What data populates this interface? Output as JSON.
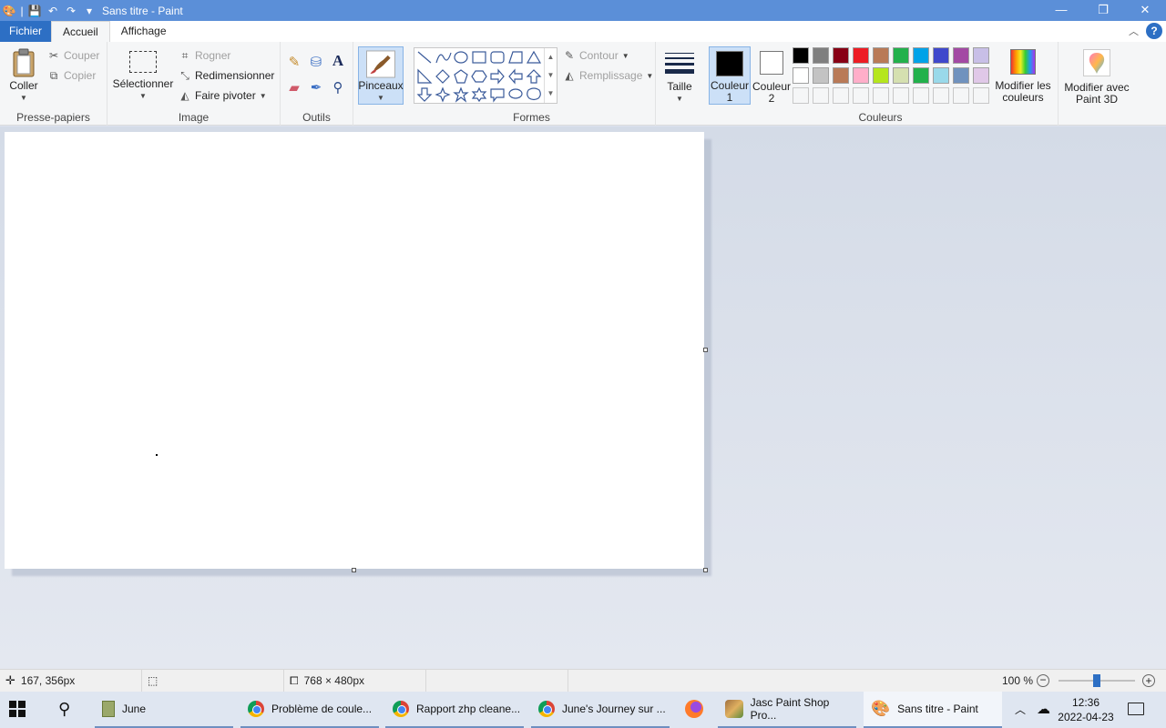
{
  "window": {
    "title": "Sans titre - Paint",
    "controls": {
      "minimize": "—",
      "restore": "❐",
      "close": "✕"
    }
  },
  "tabs": {
    "file": "Fichier",
    "home": "Accueil",
    "view": "Affichage"
  },
  "ribbon": {
    "clipboard": {
      "label": "Presse-papiers",
      "paste": "Coller",
      "cut": "Couper",
      "copy": "Copier"
    },
    "image": {
      "label": "Image",
      "select": "Sélectionner",
      "crop": "Rogner",
      "resize": "Redimensionner",
      "rotate": "Faire pivoter"
    },
    "tools": {
      "label": "Outils"
    },
    "brushes": {
      "label": "Pinceaux"
    },
    "shapes": {
      "label": "Formes",
      "outline": "Contour",
      "fill": "Remplissage"
    },
    "size": {
      "label": "Taille"
    },
    "colors": {
      "label": "Couleurs",
      "color1_line1": "Couleur",
      "color1_line2": "1",
      "color2_line1": "Couleur",
      "color2_line2": "2",
      "edit_line1": "Modifier les",
      "edit_line2": "couleurs",
      "paint3d_line1": "Modifier avec",
      "paint3d_line2": "Paint 3D",
      "color1_value": "#000000",
      "color2_value": "#ffffff",
      "row1": [
        "#000000",
        "#7f7f7f",
        "#880015",
        "#ed1c24",
        "#b97a57",
        "#22b14c",
        "#00a2e8",
        "#3f48cc",
        "#a349a4",
        "#c8bfe7"
      ],
      "row2": [
        "#ffffff",
        "#c3c3c3",
        "#b97a57",
        "#ffaec9",
        "#b5e61d",
        "#d5e0b0",
        "#22b14c",
        "#99d9ea",
        "#7092be",
        "#e0c8e8"
      ]
    }
  },
  "status": {
    "cursor_pos": "167, 356px",
    "canvas_size": "768 × 480px",
    "zoom": "100 %"
  },
  "taskbar": {
    "items": [
      {
        "label": "June"
      },
      {
        "label": "Problème de coule..."
      },
      {
        "label": "Rapport zhp cleane..."
      },
      {
        "label": "June's Journey sur ..."
      },
      {
        "label": "Jasc Paint Shop Pro..."
      },
      {
        "label": "Sans titre - Paint"
      }
    ],
    "time": "12:36",
    "date": "2022-04-23"
  }
}
